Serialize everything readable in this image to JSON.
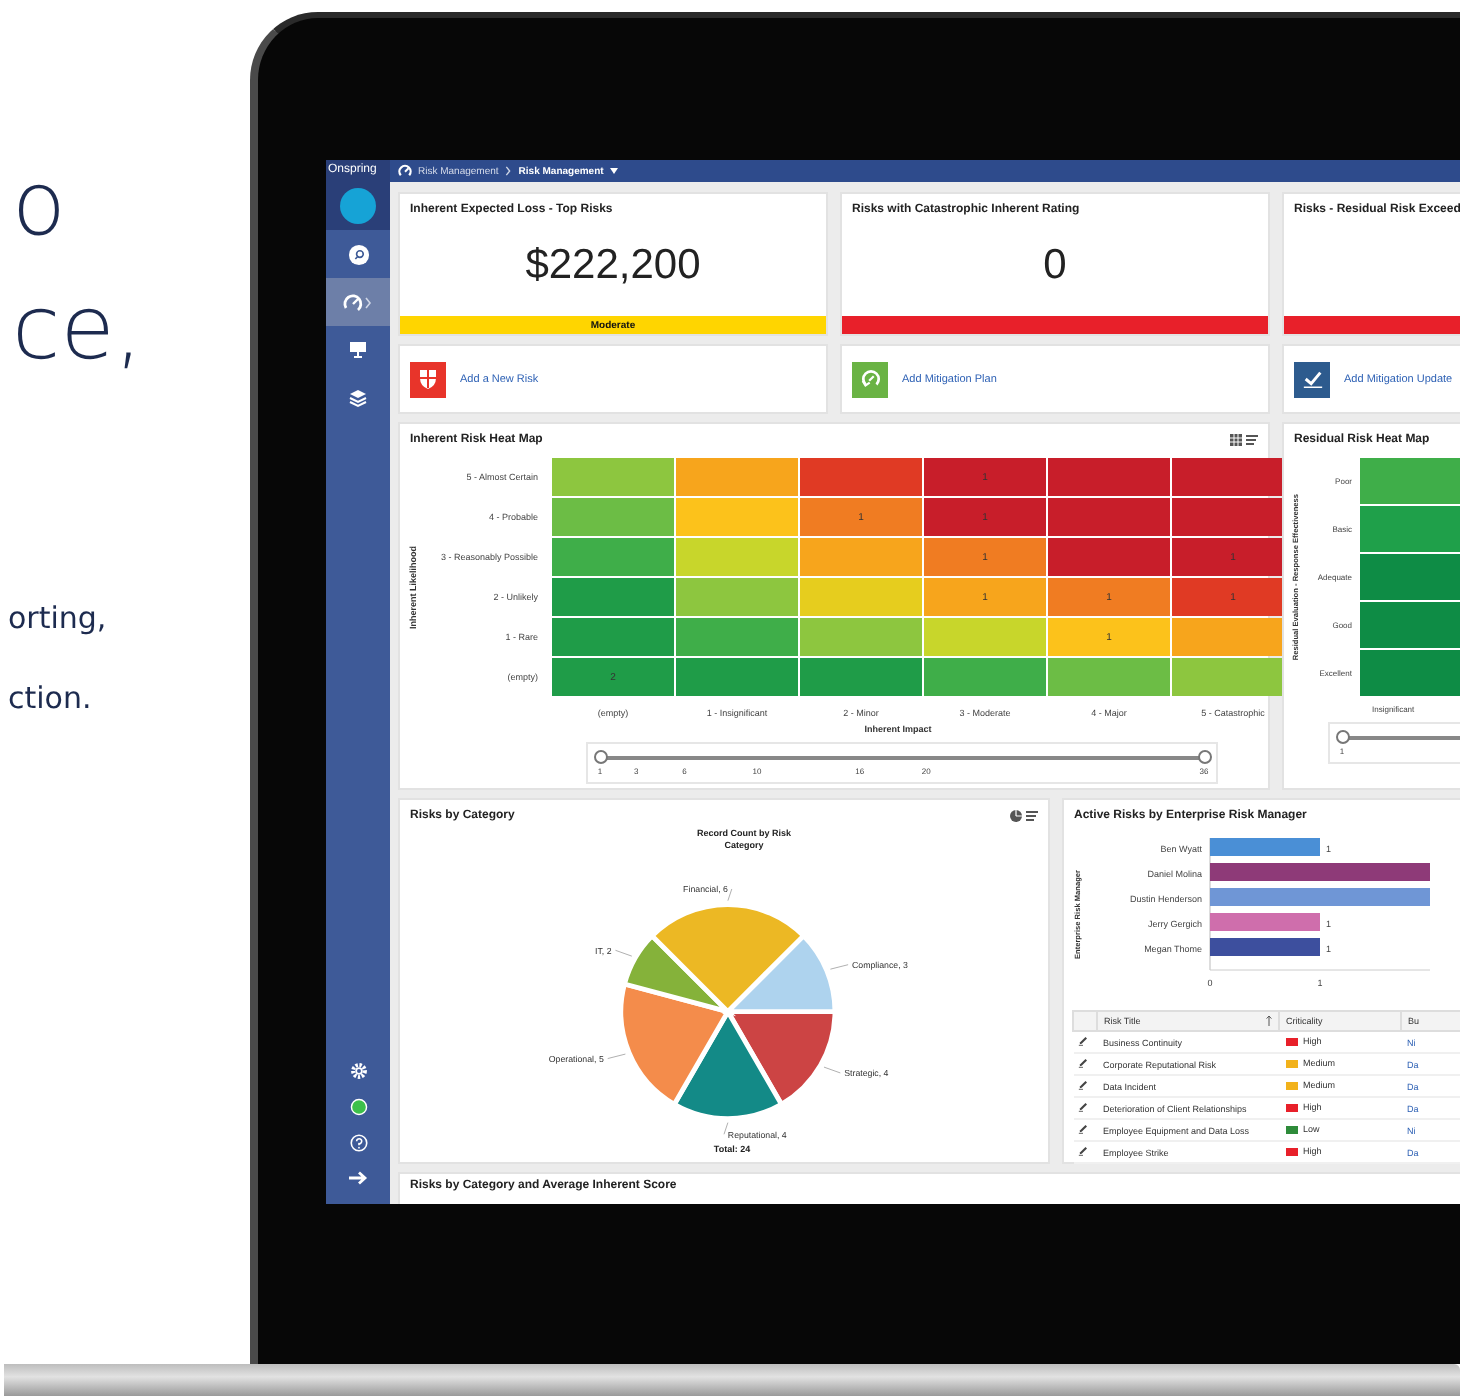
{
  "promo_text": {
    "heading_lines": [
      "o",
      "ce,"
    ],
    "body_lines": [
      "orting,",
      "ction."
    ]
  },
  "app": {
    "logo": "Onspring",
    "sidebar": {
      "items": [
        {
          "selected": false
        },
        {
          "selected": true
        },
        {
          "selected": false
        },
        {
          "selected": false
        }
      ]
    },
    "breadcrumb": [
      "Risk Management",
      "Risk Management"
    ],
    "kpi_cards": [
      {
        "title": "Inherent Expected Loss - Top Risks",
        "value": "$222,200",
        "band": "Moderate",
        "color": "#ffd500"
      },
      {
        "title": "Risks with Catastrophic Inherent Rating",
        "value": "0",
        "color": "#e8202a"
      },
      {
        "title": "Risks - Residual Risk Exceed",
        "color": "#e8202a"
      }
    ],
    "actions": [
      {
        "label": "Add a New Risk",
        "color": "#e8342a"
      },
      {
        "label": "Add Mitigation Plan",
        "color": "#6ab344"
      },
      {
        "label": "Add Mitigation Update",
        "color": "#2d5b8e"
      }
    ],
    "heat_map": {
      "title": "Inherent Risk Heat Map",
      "ylabel": "Inherent Likelihood",
      "xlabel": "Inherent Impact",
      "row_labels": [
        "5 - Almost Certain",
        "4 - Probable",
        "3 - Reasonably Possible",
        "2 - Unlikely",
        "1 - Rare",
        "(empty)"
      ],
      "column_labels": [
        "(empty)",
        "1 - Insignificant",
        "2 - Minor",
        "3 - Moderate",
        "4 - Major",
        "5 - Catastrophic"
      ],
      "rows": [
        [
          {
            "color": "#8dc63f"
          },
          {
            "color": "#f7a51c"
          },
          {
            "color": "#e03a24"
          },
          {
            "color": "#c81e2a",
            "value": "1"
          },
          {
            "color": "#c81e2a"
          },
          {
            "color": "#c81e2a"
          }
        ],
        [
          {
            "color": "#6cbd45"
          },
          {
            "color": "#fcc21b"
          },
          {
            "color": "#f07c22",
            "value": "1"
          },
          {
            "color": "#c81e2a",
            "value": "1"
          },
          {
            "color": "#c81e2a"
          },
          {
            "color": "#c81e2a"
          }
        ],
        [
          {
            "color": "#3fae49"
          },
          {
            "color": "#c8d62b"
          },
          {
            "color": "#f7a51c"
          },
          {
            "color": "#f07c22",
            "value": "1"
          },
          {
            "color": "#c81e2a"
          },
          {
            "color": "#c81e2a",
            "value": "1"
          }
        ],
        [
          {
            "color": "#1f9c48"
          },
          {
            "color": "#8dc63f"
          },
          {
            "color": "#e6cd1e"
          },
          {
            "color": "#f7a51c",
            "value": "1"
          },
          {
            "color": "#f07c22",
            "value": "1"
          },
          {
            "color": "#e03a24",
            "value": "1"
          }
        ],
        [
          {
            "color": "#1f9c48"
          },
          {
            "color": "#3fae49"
          },
          {
            "color": "#8dc63f"
          },
          {
            "color": "#c8d62b"
          },
          {
            "color": "#fcc21b",
            "value": "1"
          },
          {
            "color": "#f7a51c"
          }
        ],
        [
          {
            "color": "#1f9c48",
            "value": "2"
          },
          {
            "color": "#1f9c48"
          },
          {
            "color": "#1f9c48"
          },
          {
            "color": "#3fae49"
          },
          {
            "color": "#6cbd45"
          },
          {
            "color": "#8dc63f"
          }
        ]
      ],
      "slider": {
        "ticks": [
          "1",
          "3",
          "6",
          "10",
          "16",
          "20",
          "36"
        ],
        "thumbs": [
          {
            "level": 0
          },
          {
            "level": 1
          }
        ]
      }
    },
    "residual_map": {
      "title": "Residual Risk Heat Map",
      "ylabel": "Residual Evaluation - Response Effectiveness",
      "xlabel": "Insignificant",
      "rows": [
        {
          "label": "Poor",
          "color": "#3fae49"
        },
        {
          "label": "Basic",
          "color": "#1fa04a"
        },
        {
          "label": "Adequate",
          "color": "#0e8c45"
        },
        {
          "label": "Good",
          "color": "#0e8c45"
        },
        {
          "label": "Excellent",
          "color": "#0e8c45"
        }
      ],
      "slider": {
        "ticks": [
          "1"
        ],
        "thumbs": [
          {
            "level": 0
          }
        ]
      }
    },
    "pie_card": {
      "title": "Risks by Category",
      "chart_data": {
        "type": "pie",
        "title": "Record Count by Risk Category",
        "categories": [
          "Strategic, 4",
          "Reputational, 4",
          "Operational, 5",
          "IT, 2",
          "Financial, 6",
          "Compliance, 3"
        ],
        "series": [
          {
            "values": [
              4,
              4,
              5,
              2,
              6,
              3
            ]
          }
        ],
        "colors": [
          "#cc4444",
          "#138a87",
          "#f48c4b",
          "#85b23a",
          "#ecb824",
          "#aed3ee"
        ],
        "annotations": [
          "Total: 24"
        ]
      }
    },
    "managers_card": {
      "title": "Active Risks by Enterprise Risk Manager",
      "chart_data": {
        "type": "bar",
        "orientation": "horizontal",
        "ylabel": "Enterprise Risk Manager",
        "series": [
          {
            "name": "Ben Wyatt",
            "color": "#4a8fd6",
            "values": [
              1
            ]
          },
          {
            "name": "Daniel Molina",
            "color": "#8e3a78",
            "values": [
              2
            ]
          },
          {
            "name": "Dustin Henderson",
            "color": "#6f96d6",
            "values": [
              2
            ]
          },
          {
            "name": "Jerry Gergich",
            "color": "#cf6eac",
            "values": [
              1
            ]
          },
          {
            "name": "Megan Thome",
            "color": "#3d4f9e",
            "values": [
              1
            ]
          }
        ],
        "value_labels": [
          "1",
          null,
          null,
          "1",
          "1"
        ],
        "xlim": [
          0,
          2
        ],
        "xticks": [
          0,
          1
        ]
      },
      "table": {
        "columns": [
          "Risk Title",
          "Criticality",
          "Bu"
        ],
        "rows": [
          {
            "risk_title": "Business Continuity",
            "criticality": "High",
            "column_3": "Ni",
            "color": "#e8202a"
          },
          {
            "risk_title": "Corporate Reputational Risk",
            "criticality": "Medium",
            "column_3": "Da",
            "color": "#f2b21b"
          },
          {
            "risk_title": "Data Incident",
            "criticality": "Medium",
            "column_3": "Da",
            "color": "#f2b21b"
          },
          {
            "risk_title": "Deterioration of Client Relationships",
            "criticality": "High",
            "column_3": "Da",
            "color": "#e8202a"
          },
          {
            "risk_title": "Employee Equipment and Data Loss",
            "criticality": "Low",
            "column_3": "Ni",
            "color": "#2e8b3a"
          },
          {
            "risk_title": "Employee Strike",
            "criticality": "High",
            "column_3": "Da",
            "color": "#e8202a"
          }
        ]
      }
    },
    "bottom_card": {
      "title": "Risks by Category and Average Inherent Score"
    }
  }
}
